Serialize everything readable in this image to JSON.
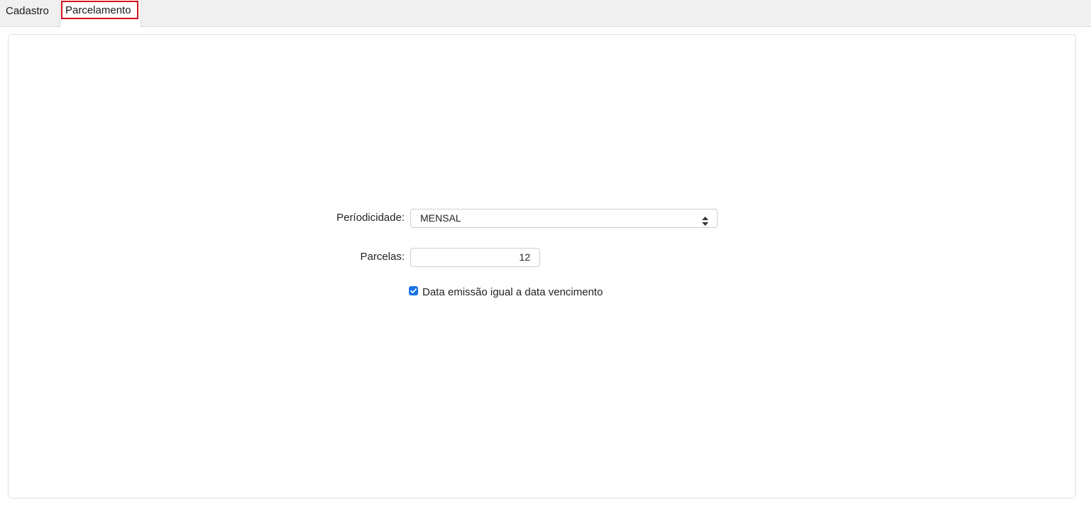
{
  "tabs": [
    {
      "label": "Cadastro",
      "active": false
    },
    {
      "label": "Parcelamento",
      "active": true
    }
  ],
  "form": {
    "periodicidade_label": "Períodicidade:",
    "periodicidade_value": "MENSAL",
    "parcelas_label": "Parcelas:",
    "parcelas_value": "12",
    "data_emissao_label": "Data emissão igual a data vencimento",
    "data_emissao_checked": true
  },
  "colors": {
    "accent": "#1a73e8",
    "focus_ring": "#d4141e"
  },
  "icons": {
    "select_arrows": "sort-arrows-icon",
    "checkbox_check": "checkmark-icon"
  }
}
